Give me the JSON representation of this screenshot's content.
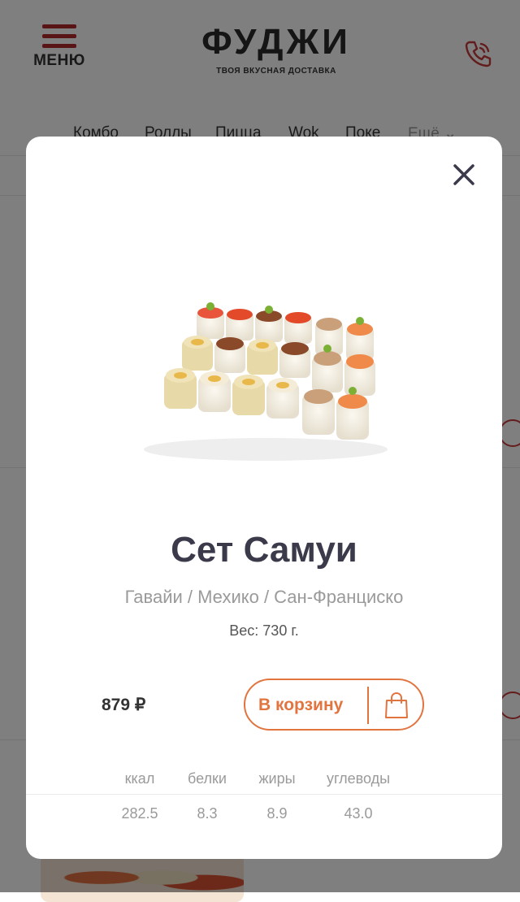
{
  "header": {
    "menu_label": "МЕНЮ",
    "logo_title": "ФУДЖИ",
    "logo_subtitle": "ТВОЯ ВКУСНАЯ ДОСТАВКА",
    "phone_icon": "phone-icon"
  },
  "nav": {
    "items": [
      "Комбо",
      "Роллы",
      "Пицца",
      "Wok",
      "Поке",
      "Ещё"
    ]
  },
  "modal": {
    "close_icon": "close-icon",
    "title": "Сет Самуи",
    "composition": "Гавайи / Мехико / Сан-Франциско",
    "weight": "Вес: 730 г.",
    "price": "879 ₽",
    "add_to_cart": "В корзину",
    "cart_icon": "shopping-bag-icon",
    "nutrition": {
      "headers": [
        "ккал",
        "белки",
        "жиры",
        "углеводы"
      ],
      "values": [
        "282.5",
        "8.3",
        "8.9",
        "43.0"
      ]
    }
  },
  "colors": {
    "accent_red": "#b22b2b",
    "accent_orange": "#e2743f",
    "overlay": "rgba(0,0,0,0.5)"
  }
}
